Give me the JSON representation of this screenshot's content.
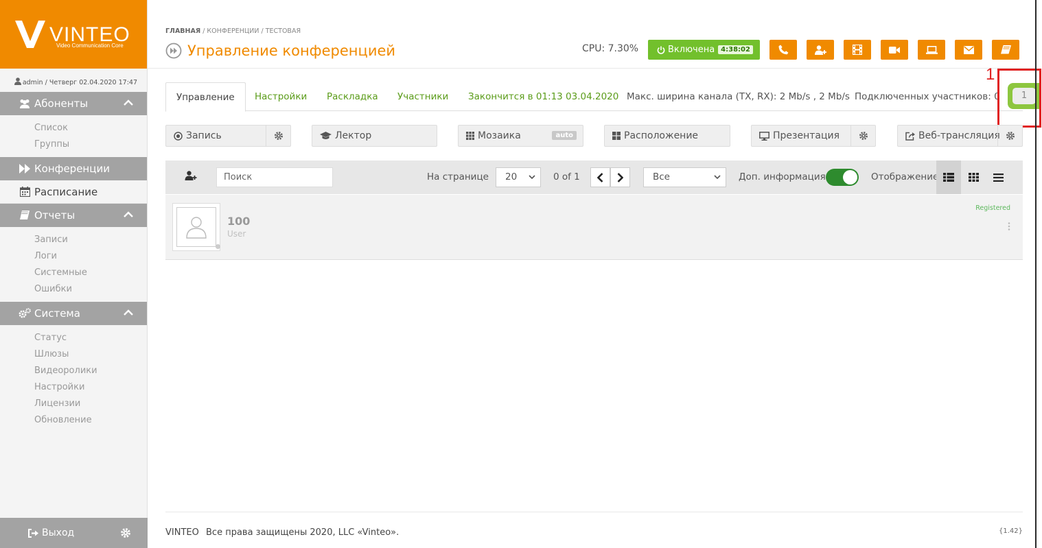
{
  "brand": {
    "name": "VINTEO",
    "subtitle": "Video Communication Core"
  },
  "user_line": "admin / Четверг 02.04.2020 17:47",
  "sidebar": {
    "subscribers": {
      "label": "Абоненты",
      "items": [
        "Список",
        "Группы"
      ]
    },
    "conferences": {
      "label": "Конференции"
    },
    "schedule": {
      "label": "Расписание"
    },
    "reports": {
      "label": "Отчеты",
      "items": [
        "Записи",
        "Логи",
        "Системные",
        "Ошибки"
      ]
    },
    "system": {
      "label": "Система",
      "items": [
        "Статус",
        "Шлюзы",
        "Видеоролики",
        "Настройки",
        "Лицензии",
        "Обновление"
      ]
    },
    "logout": "Выход"
  },
  "breadcrumb": {
    "home": "ГЛАВНАЯ",
    "sep1": "/",
    "conferences": "КОНФЕРЕНЦИИ",
    "sep2": "/",
    "current": "ТЕСТОВАЯ"
  },
  "page_title": "Управление конференцией",
  "cpu": "CPU: 7.30%",
  "status_button": {
    "label": "Включена",
    "timer": "4:38:02"
  },
  "tabs": {
    "control": "Управление",
    "settings": "Настройки",
    "layout": "Раскладка",
    "participants": "Участники",
    "ends": "Закончится в 01:13 03.04.2020",
    "bandwidth": "Макс. ширина канала (TX, RX): 2 Mb/s , 2 Mb/s",
    "connected": "Подключенных участников: 0"
  },
  "participant_count": "1",
  "annotation_label": "1",
  "controls": {
    "record": "Запись",
    "lecturer": "Лектор",
    "mosaic": "Мозаика",
    "mosaic_badge": "auto",
    "arrangement": "Расположение",
    "presentation": "Презентация",
    "webcast": "Веб-трансляция"
  },
  "toolbar": {
    "search_placeholder": "Поиск",
    "per_page_label": "На странице",
    "per_page_value": "20",
    "page_info": "0 of 1",
    "filter_value": "Все",
    "extra_info_label": "Доп. информация",
    "display_label": "Отображение"
  },
  "participant": {
    "number": "100",
    "type": "User",
    "status": "Registered"
  },
  "footer": {
    "brand": "VINTEO",
    "copyright": "Все права защищены 2020, LLC «Vinteo».",
    "version": "{1.42}"
  },
  "colors": {
    "accent_orange": "#f08a00",
    "active_green": "#72c02c",
    "sidebar_section": "#a3a3a3",
    "annotation_red": "#e02020"
  }
}
